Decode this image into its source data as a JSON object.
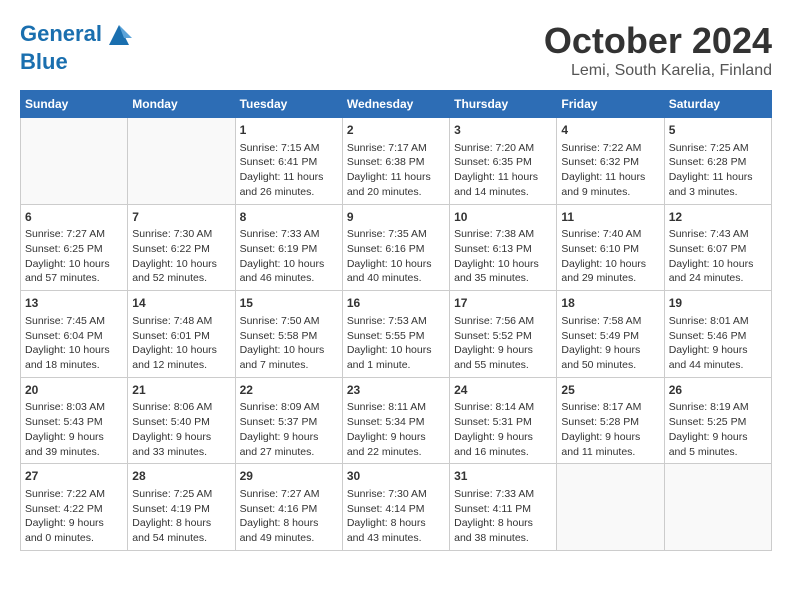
{
  "header": {
    "logo_line1": "General",
    "logo_line2": "Blue",
    "month": "October 2024",
    "location": "Lemi, South Karelia, Finland"
  },
  "days_of_week": [
    "Sunday",
    "Monday",
    "Tuesday",
    "Wednesday",
    "Thursday",
    "Friday",
    "Saturday"
  ],
  "weeks": [
    [
      {
        "day": "",
        "content": ""
      },
      {
        "day": "",
        "content": ""
      },
      {
        "day": "1",
        "content": "Sunrise: 7:15 AM\nSunset: 6:41 PM\nDaylight: 11 hours and 26 minutes."
      },
      {
        "day": "2",
        "content": "Sunrise: 7:17 AM\nSunset: 6:38 PM\nDaylight: 11 hours and 20 minutes."
      },
      {
        "day": "3",
        "content": "Sunrise: 7:20 AM\nSunset: 6:35 PM\nDaylight: 11 hours and 14 minutes."
      },
      {
        "day": "4",
        "content": "Sunrise: 7:22 AM\nSunset: 6:32 PM\nDaylight: 11 hours and 9 minutes."
      },
      {
        "day": "5",
        "content": "Sunrise: 7:25 AM\nSunset: 6:28 PM\nDaylight: 11 hours and 3 minutes."
      }
    ],
    [
      {
        "day": "6",
        "content": "Sunrise: 7:27 AM\nSunset: 6:25 PM\nDaylight: 10 hours and 57 minutes."
      },
      {
        "day": "7",
        "content": "Sunrise: 7:30 AM\nSunset: 6:22 PM\nDaylight: 10 hours and 52 minutes."
      },
      {
        "day": "8",
        "content": "Sunrise: 7:33 AM\nSunset: 6:19 PM\nDaylight: 10 hours and 46 minutes."
      },
      {
        "day": "9",
        "content": "Sunrise: 7:35 AM\nSunset: 6:16 PM\nDaylight: 10 hours and 40 minutes."
      },
      {
        "day": "10",
        "content": "Sunrise: 7:38 AM\nSunset: 6:13 PM\nDaylight: 10 hours and 35 minutes."
      },
      {
        "day": "11",
        "content": "Sunrise: 7:40 AM\nSunset: 6:10 PM\nDaylight: 10 hours and 29 minutes."
      },
      {
        "day": "12",
        "content": "Sunrise: 7:43 AM\nSunset: 6:07 PM\nDaylight: 10 hours and 24 minutes."
      }
    ],
    [
      {
        "day": "13",
        "content": "Sunrise: 7:45 AM\nSunset: 6:04 PM\nDaylight: 10 hours and 18 minutes."
      },
      {
        "day": "14",
        "content": "Sunrise: 7:48 AM\nSunset: 6:01 PM\nDaylight: 10 hours and 12 minutes."
      },
      {
        "day": "15",
        "content": "Sunrise: 7:50 AM\nSunset: 5:58 PM\nDaylight: 10 hours and 7 minutes."
      },
      {
        "day": "16",
        "content": "Sunrise: 7:53 AM\nSunset: 5:55 PM\nDaylight: 10 hours and 1 minute."
      },
      {
        "day": "17",
        "content": "Sunrise: 7:56 AM\nSunset: 5:52 PM\nDaylight: 9 hours and 55 minutes."
      },
      {
        "day": "18",
        "content": "Sunrise: 7:58 AM\nSunset: 5:49 PM\nDaylight: 9 hours and 50 minutes."
      },
      {
        "day": "19",
        "content": "Sunrise: 8:01 AM\nSunset: 5:46 PM\nDaylight: 9 hours and 44 minutes."
      }
    ],
    [
      {
        "day": "20",
        "content": "Sunrise: 8:03 AM\nSunset: 5:43 PM\nDaylight: 9 hours and 39 minutes."
      },
      {
        "day": "21",
        "content": "Sunrise: 8:06 AM\nSunset: 5:40 PM\nDaylight: 9 hours and 33 minutes."
      },
      {
        "day": "22",
        "content": "Sunrise: 8:09 AM\nSunset: 5:37 PM\nDaylight: 9 hours and 27 minutes."
      },
      {
        "day": "23",
        "content": "Sunrise: 8:11 AM\nSunset: 5:34 PM\nDaylight: 9 hours and 22 minutes."
      },
      {
        "day": "24",
        "content": "Sunrise: 8:14 AM\nSunset: 5:31 PM\nDaylight: 9 hours and 16 minutes."
      },
      {
        "day": "25",
        "content": "Sunrise: 8:17 AM\nSunset: 5:28 PM\nDaylight: 9 hours and 11 minutes."
      },
      {
        "day": "26",
        "content": "Sunrise: 8:19 AM\nSunset: 5:25 PM\nDaylight: 9 hours and 5 minutes."
      }
    ],
    [
      {
        "day": "27",
        "content": "Sunrise: 7:22 AM\nSunset: 4:22 PM\nDaylight: 9 hours and 0 minutes."
      },
      {
        "day": "28",
        "content": "Sunrise: 7:25 AM\nSunset: 4:19 PM\nDaylight: 8 hours and 54 minutes."
      },
      {
        "day": "29",
        "content": "Sunrise: 7:27 AM\nSunset: 4:16 PM\nDaylight: 8 hours and 49 minutes."
      },
      {
        "day": "30",
        "content": "Sunrise: 7:30 AM\nSunset: 4:14 PM\nDaylight: 8 hours and 43 minutes."
      },
      {
        "day": "31",
        "content": "Sunrise: 7:33 AM\nSunset: 4:11 PM\nDaylight: 8 hours and 38 minutes."
      },
      {
        "day": "",
        "content": ""
      },
      {
        "day": "",
        "content": ""
      }
    ]
  ]
}
